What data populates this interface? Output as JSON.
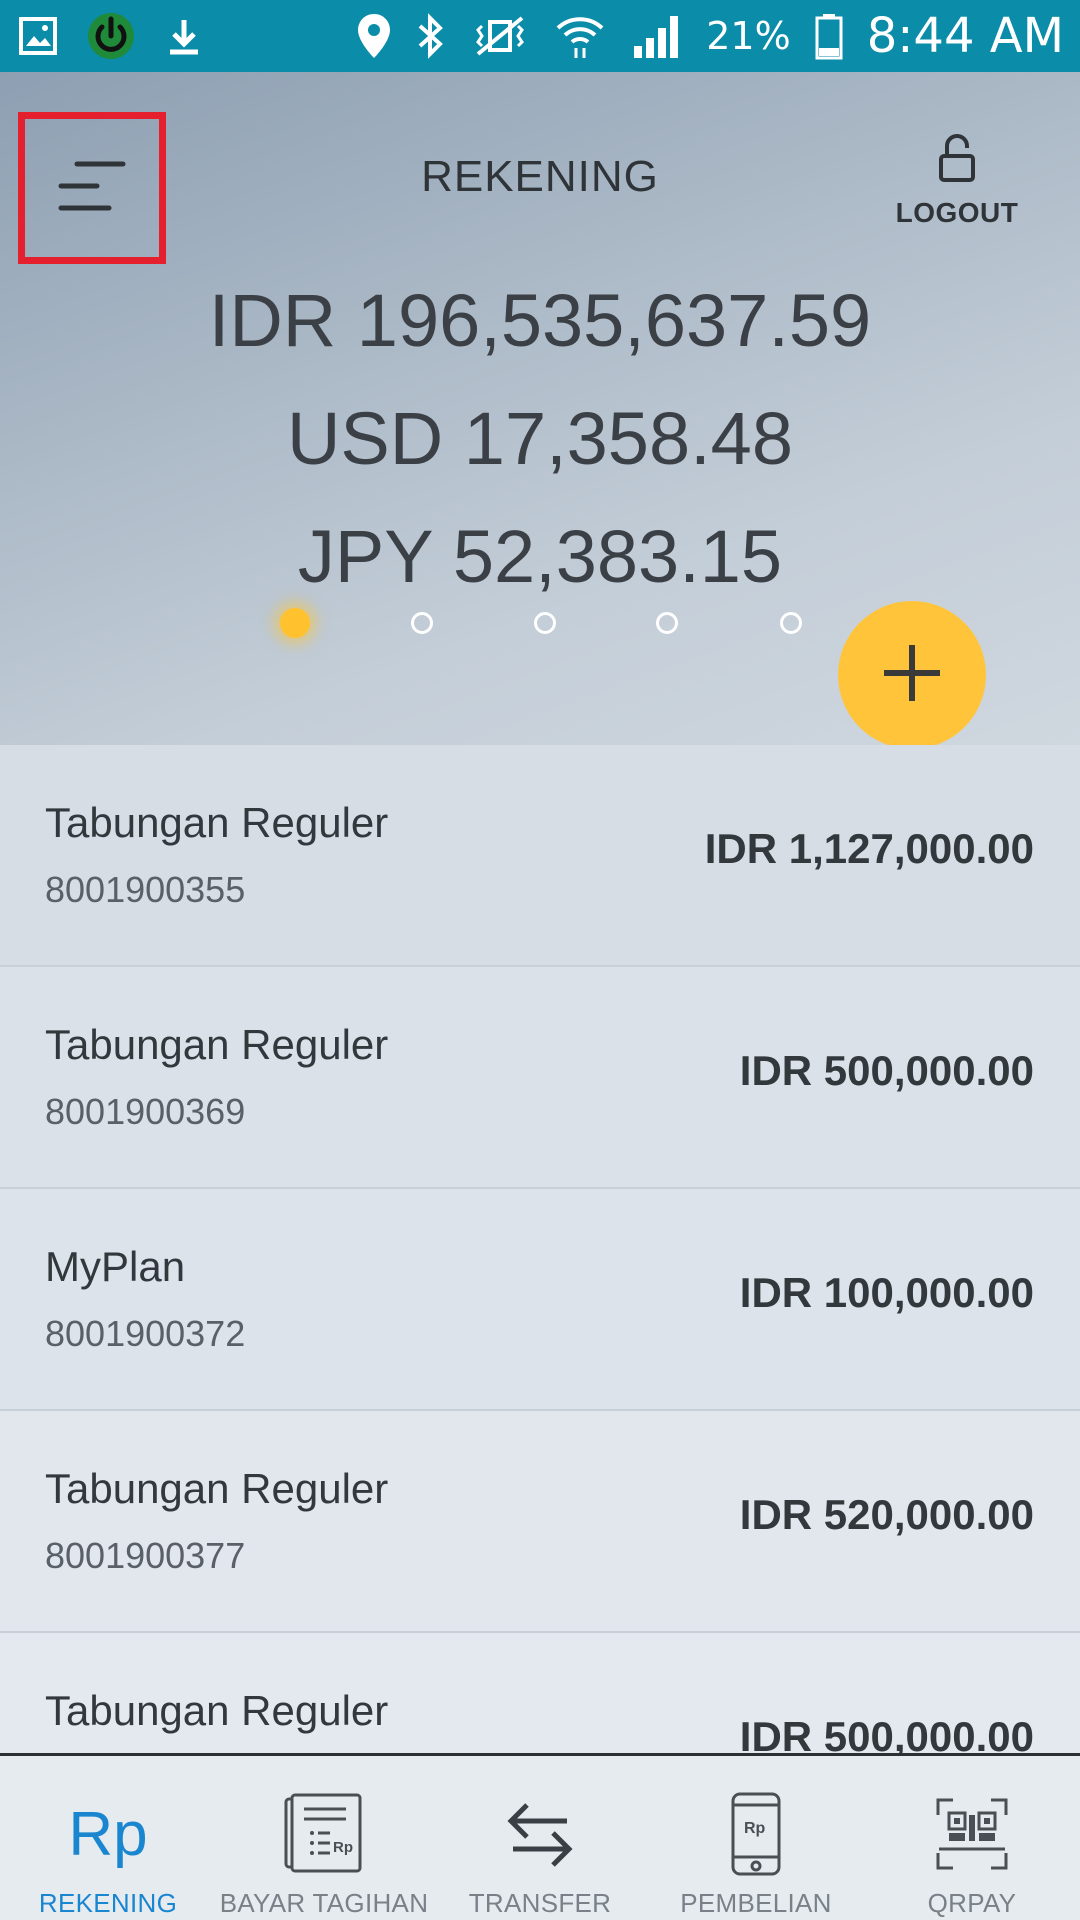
{
  "status_bar": {
    "battery": "21%",
    "time": "8:44 AM"
  },
  "header": {
    "title": "REKENING",
    "logout_label": "LOGOUT"
  },
  "balances": [
    "IDR 196,535,637.59",
    "USD 17,358.48",
    "JPY 52,383.15"
  ],
  "pager": {
    "count": 5,
    "active_index": 0
  },
  "accounts": [
    {
      "name": "Tabungan Reguler",
      "number": "8001900355",
      "balance": "IDR 1,127,000.00"
    },
    {
      "name": "Tabungan Reguler",
      "number": "8001900369",
      "balance": "IDR 500,000.00"
    },
    {
      "name": "MyPlan",
      "number": "8001900372",
      "balance": "IDR 100,000.00"
    },
    {
      "name": "Tabungan Reguler",
      "number": "8001900377",
      "balance": "IDR 520,000.00"
    },
    {
      "name": "Tabungan Reguler",
      "number": "",
      "balance": "IDR 500,000.00"
    }
  ],
  "bottom_nav": [
    {
      "label": "REKENING",
      "icon": "rp-icon",
      "icon_text": "Rp",
      "active": true
    },
    {
      "label": "BAYAR TAGIHAN",
      "icon": "bill-icon"
    },
    {
      "label": "TRANSFER",
      "icon": "transfer-arrows-icon"
    },
    {
      "label": "PEMBELIAN",
      "icon": "phone-purchase-icon"
    },
    {
      "label": "QRPAY",
      "icon": "qr-scan-icon"
    }
  ],
  "colors": {
    "status_bar": "#0b8ca8",
    "accent_yellow": "#ffc43a",
    "active_nav": "#1a86d0",
    "highlight_border": "#e5202e"
  }
}
